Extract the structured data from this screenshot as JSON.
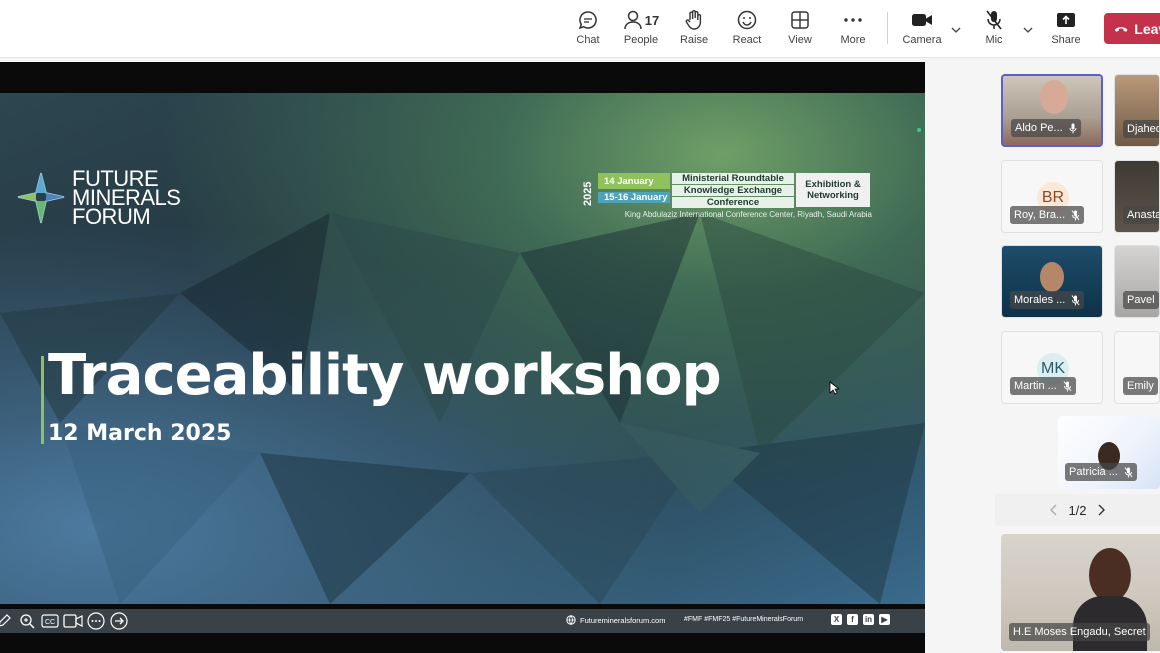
{
  "toolbar": {
    "chat": "Chat",
    "people": "People",
    "people_count": "17",
    "raise": "Raise",
    "react": "React",
    "view": "View",
    "more": "More",
    "camera": "Camera",
    "mic": "Mic",
    "share": "Share",
    "leave": "Leave"
  },
  "slide": {
    "logo_line1": "FUTURE",
    "logo_line2": "MINERALS",
    "logo_line3": "FORUM",
    "year": "2025",
    "date1": "14 January",
    "date2": "15-16 January",
    "box1": "Ministerial Roundtable",
    "box2": "Knowledge Exchange",
    "box3": "Conference",
    "exhibition": "Exhibition & Networking",
    "venue": "King Abdulaziz International Conference Center, Riyadh, Saudi Arabia",
    "title": "Traceability workshop",
    "date": "12 March 2025",
    "footer_site": "Futuremineralsforum.com",
    "footer_tags": "#FMF   #FMF25   #FutureMineralsForum"
  },
  "participants": [
    {
      "name": "Aldo Pe..."
    },
    {
      "name": "Djahed"
    },
    {
      "name": "Roy, Bra...",
      "initials": "BR"
    },
    {
      "name": "Anasta"
    },
    {
      "name": "Morales ..."
    },
    {
      "name": "Pavel"
    },
    {
      "name": "Martin ...",
      "initials": "MK"
    },
    {
      "name": "Emily"
    },
    {
      "name": "Patricia ..."
    }
  ],
  "pager": {
    "label": "1/2"
  },
  "spotlight": {
    "name": "H.E Moses Engadu, Secret"
  },
  "colors": {
    "leave": "#c4314b",
    "speaking": "#5b5fc7",
    "accent_green": "#8fc25a"
  }
}
